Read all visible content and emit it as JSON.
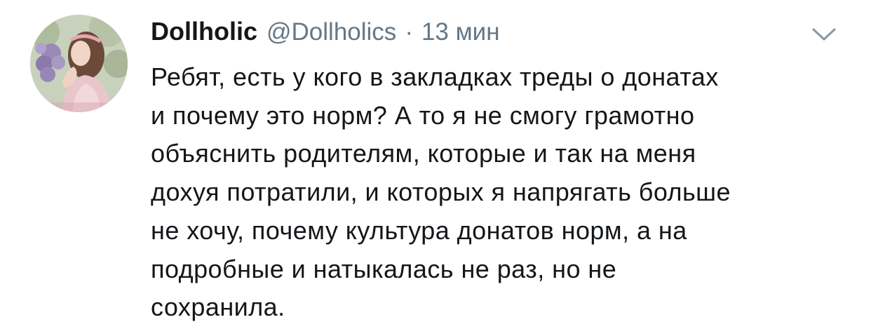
{
  "tweet": {
    "author": {
      "display_name": "Dollholic",
      "handle": "@Dollholics"
    },
    "separator": "·",
    "timestamp": "13 мин",
    "text": "Ребят, есть у кого в закладках треды о донатах\nи почему это норм? А то я не смогу грамотно\nобъяснить родителям, которые и так на меня\nдохуя потратили, и которых я напрягать больше\nне хочу, почему культура донатов норм, а на\nподробные и натыкалась не раз, но не\nсохранила.",
    "menu_icon": "chevron-down-icon",
    "avatar_icon": "avatar"
  },
  "colors": {
    "text_primary": "#14171a",
    "text_secondary": "#657786",
    "chevron": "#8899a6",
    "background": "#ffffff"
  }
}
